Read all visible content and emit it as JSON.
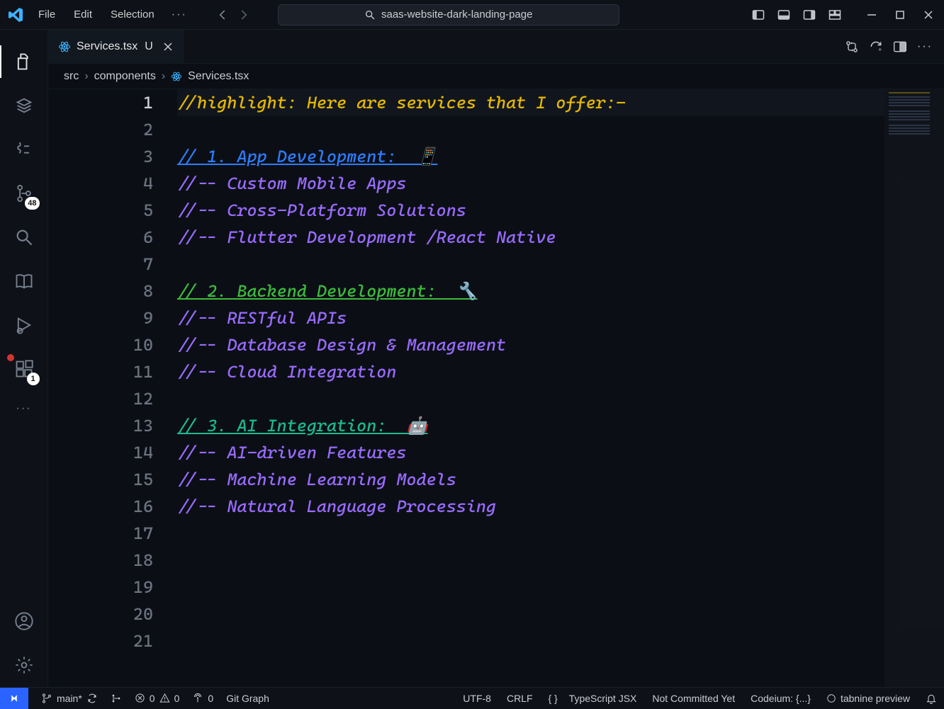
{
  "menu": {
    "file": "File",
    "edit": "Edit",
    "selection": "Selection"
  },
  "search": {
    "text": "saas-website-dark-landing-page"
  },
  "tab": {
    "label": "Services.tsx",
    "dirty": "U"
  },
  "breadcrumb": {
    "p1": "src",
    "p2": "components",
    "p3": "Services.tsx"
  },
  "activity": {
    "scm_badge": "48",
    "ext_badge": "1"
  },
  "code": {
    "lines": [
      "//highlight: Here are services that I offer:-",
      "",
      "// 1. App Development:  📱",
      "//-- Custom Mobile Apps",
      "//-- Cross-Platform Solutions",
      "//-- Flutter Development /React Native",
      "",
      "// 2. Backend Development:  🔧",
      "//-- RESTful APIs",
      "//-- Database Design & Management",
      "//-- Cloud Integration",
      "",
      "// 3. AI Integration:  🤖",
      "//-- AI-driven Features",
      "//-- Machine Learning Models",
      "//-- Natural Language Processing",
      "",
      "",
      "",
      "",
      ""
    ]
  },
  "status": {
    "branch": "main*",
    "errors": "0",
    "warnings": "0",
    "ports": "0",
    "gitgraph": "Git Graph",
    "encoding": "UTF-8",
    "eol": "CRLF",
    "lang_icon": "{ }",
    "lang": "TypeScript JSX",
    "commit": "Not Committed Yet",
    "codeium": "Codeium: {...}",
    "tabnine": "tabnine preview"
  }
}
